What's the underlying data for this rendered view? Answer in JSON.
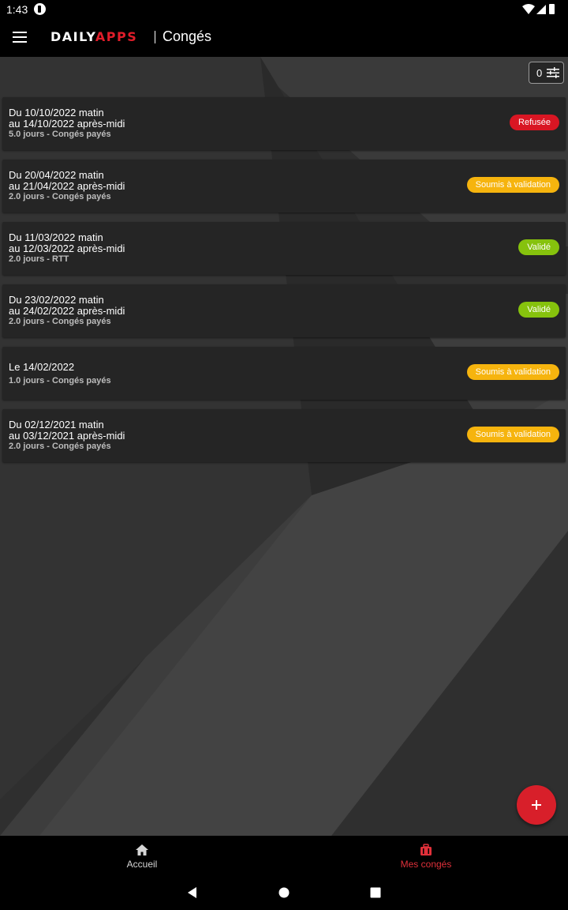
{
  "status_bar": {
    "time": "1:43"
  },
  "app_bar": {
    "logo_part1": "DAILY",
    "logo_part2": "APPS",
    "title": "Congés"
  },
  "filter": {
    "count": "0"
  },
  "leaves": [
    {
      "line1": "Du 10/10/2022 matin",
      "line2": "au 14/10/2022 après-midi",
      "meta": "5.0 jours - Congés payés",
      "status": "Refusée",
      "status_color": "#d91623"
    },
    {
      "line1": "Du 20/04/2022 matin",
      "line2": "au 21/04/2022 après-midi",
      "meta": "2.0 jours - Congés payés",
      "status": "Soumis à validation",
      "status_color": "#f6b40e"
    },
    {
      "line1": "Du 11/03/2022 matin",
      "line2": "au 12/03/2022 après-midi",
      "meta": "2.0 jours - RTT",
      "status": "Validé",
      "status_color": "#86c20d"
    },
    {
      "line1": "Du 23/02/2022 matin",
      "line2": "au 24/02/2022 après-midi",
      "meta": "2.0 jours - Congés payés",
      "status": "Validé",
      "status_color": "#86c20d"
    },
    {
      "line1": "Le 14/02/2022",
      "line2": "",
      "meta": "1.0 jours - Congés payés",
      "status": "Soumis à validation",
      "status_color": "#f6b40e"
    },
    {
      "line1": "Du 02/12/2021 matin",
      "line2": "au 03/12/2021 après-midi",
      "meta": "2.0 jours - Congés payés",
      "status": "Soumis à validation",
      "status_color": "#f6b40e"
    }
  ],
  "bottom_nav": {
    "home_label": "Accueil",
    "leaves_label": "Mes congés"
  },
  "colors": {
    "accent": "#d81f2a",
    "active_nav": "#e0303a",
    "inactive_nav": "#d6d6d6"
  }
}
